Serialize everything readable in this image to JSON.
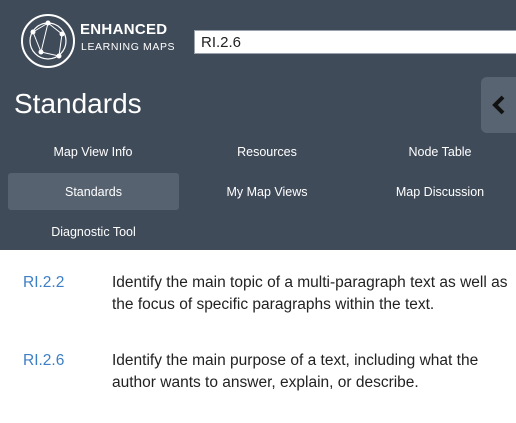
{
  "header": {
    "logo": {
      "line1": "ENHANCED",
      "line2": "LEARNING MAPS"
    },
    "search": {
      "value": "RI.2.6",
      "placeholder": ""
    }
  },
  "panel": {
    "title": "Standards",
    "collapse_icon": "chevron-left-icon"
  },
  "nav": {
    "items": [
      {
        "label": "Map View Info",
        "active": false
      },
      {
        "label": "Resources",
        "active": false
      },
      {
        "label": "Node Table",
        "active": false
      },
      {
        "label": "Standards",
        "active": true
      },
      {
        "label": "My Map Views",
        "active": false
      },
      {
        "label": "Map Discussion",
        "active": false
      },
      {
        "label": "Diagnostic Tool",
        "active": false
      }
    ]
  },
  "standards": [
    {
      "code": "RI.2.2",
      "description": "Identify the main topic of a multi-paragraph text as well as the focus of specific paragraphs within the text."
    },
    {
      "code": "RI.2.6",
      "description": "Identify the main purpose of a text, including what the author wants to answer, explain, or describe."
    }
  ],
  "colors": {
    "panel_bg": "#404b5a",
    "active_tab_bg": "#576271",
    "link": "#3d7fc4",
    "text": "#222222"
  }
}
